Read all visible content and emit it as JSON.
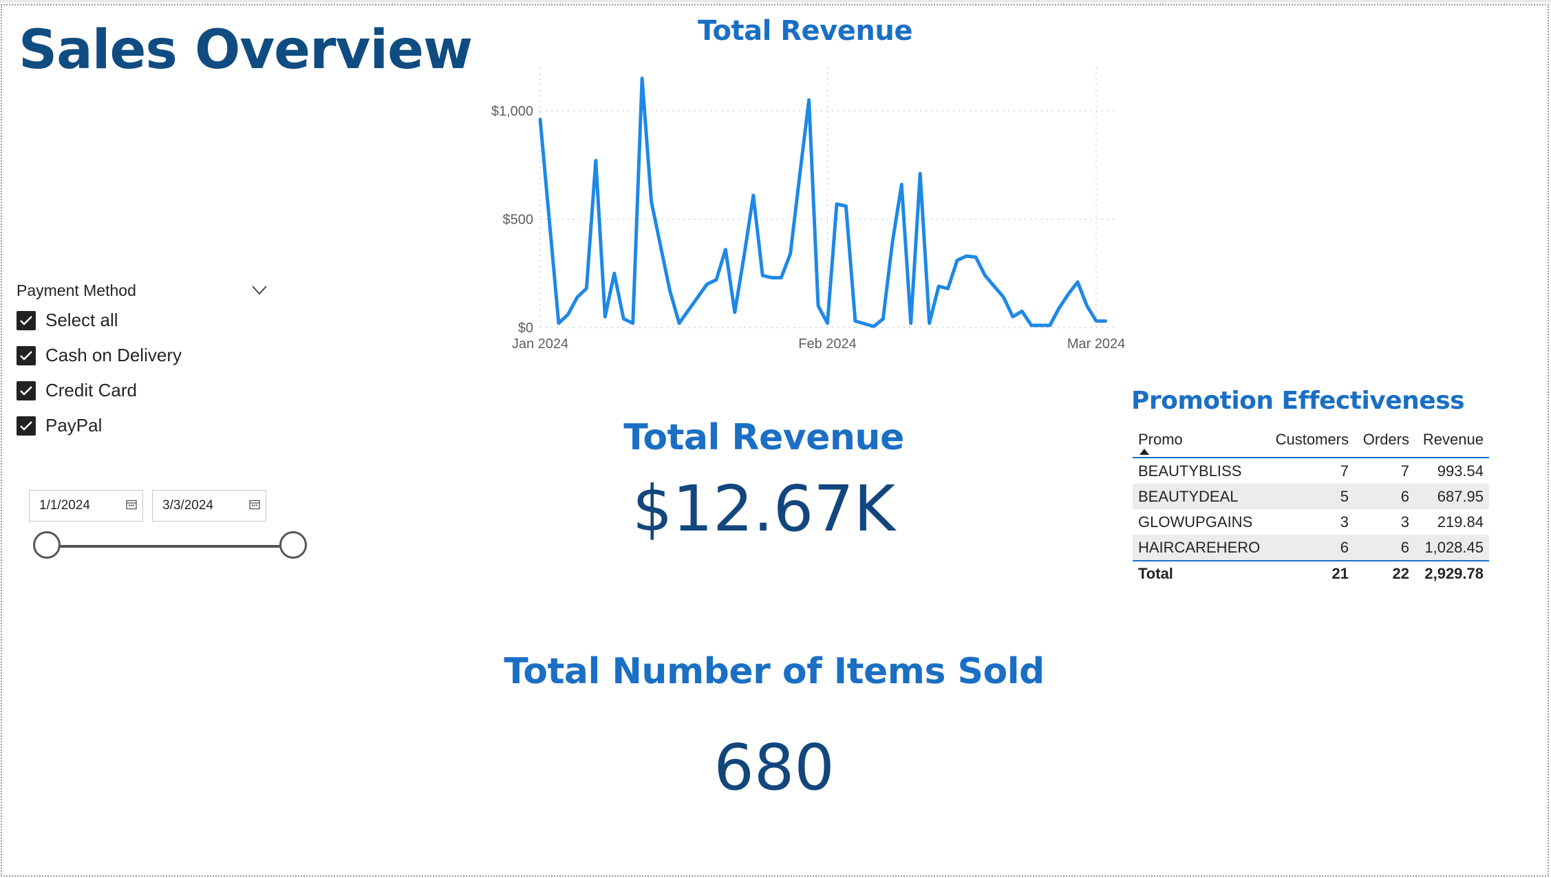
{
  "page_title": "Sales Overview",
  "slicer": {
    "title": "Payment Method",
    "items": [
      {
        "label": "Select all",
        "checked": true
      },
      {
        "label": "Cash on Delivery",
        "checked": true
      },
      {
        "label": "Credit Card",
        "checked": true
      },
      {
        "label": "PayPal",
        "checked": true
      }
    ]
  },
  "date_range": {
    "start": "1/1/2024",
    "end": "3/3/2024"
  },
  "chart_data": {
    "type": "line",
    "title": "Total Revenue",
    "x_start": "2024-01-01",
    "x_end": "2024-03-03",
    "x_ticks": [
      {
        "label": "Jan 2024",
        "date": "2024-01-01"
      },
      {
        "label": "Feb 2024",
        "date": "2024-02-01"
      },
      {
        "label": "Mar 2024",
        "date": "2024-03-01"
      }
    ],
    "y_ticks": [
      {
        "label": "$0",
        "value": 0
      },
      {
        "label": "$500",
        "value": 500
      },
      {
        "label": "$1,000",
        "value": 1000
      }
    ],
    "ylim": [
      0,
      1200
    ],
    "grid": true,
    "line_color": "#1e88e5",
    "series": [
      {
        "x": [
          "2024-01-01",
          "2024-01-03",
          "2024-01-04",
          "2024-01-05",
          "2024-01-06",
          "2024-01-07",
          "2024-01-08",
          "2024-01-09",
          "2024-01-10",
          "2024-01-11",
          "2024-01-12",
          "2024-01-13",
          "2024-01-15",
          "2024-01-16",
          "2024-01-17",
          "2024-01-18",
          "2024-01-19",
          "2024-01-20",
          "2024-01-21",
          "2024-01-22",
          "2024-01-23",
          "2024-01-24",
          "2024-01-25",
          "2024-01-26",
          "2024-01-27",
          "2024-01-28",
          "2024-01-29",
          "2024-01-30",
          "2024-01-31",
          "2024-02-01",
          "2024-02-02",
          "2024-02-03",
          "2024-02-04",
          "2024-02-06",
          "2024-02-07",
          "2024-02-08",
          "2024-02-09",
          "2024-02-10",
          "2024-02-11",
          "2024-02-12",
          "2024-02-13",
          "2024-02-14",
          "2024-02-15",
          "2024-02-16",
          "2024-02-17",
          "2024-02-18",
          "2024-02-19",
          "2024-02-20",
          "2024-02-21",
          "2024-02-22",
          "2024-02-23",
          "2024-02-24",
          "2024-02-25",
          "2024-02-26",
          "2024-02-27",
          "2024-02-28",
          "2024-02-29",
          "2024-03-01",
          "2024-03-02"
        ],
        "y": [
          960,
          20,
          60,
          140,
          180,
          770,
          50,
          250,
          40,
          20,
          1150,
          580,
          170,
          20,
          80,
          140,
          200,
          220,
          360,
          70,
          330,
          610,
          240,
          230,
          230,
          340,
          700,
          1050,
          100,
          20,
          570,
          560,
          30,
          5,
          40,
          390,
          660,
          20,
          710,
          20,
          190,
          180,
          310,
          330,
          325,
          240,
          190,
          140,
          50,
          75,
          10,
          10,
          10,
          90,
          155,
          210,
          100,
          30,
          30
        ]
      }
    ]
  },
  "cards": {
    "revenue": {
      "label": "Total Revenue",
      "value": "$12.67K"
    },
    "items": {
      "label": "Total Number of Items Sold",
      "value": "680"
    }
  },
  "promo_table": {
    "title": "Promotion Effectiveness",
    "headers": [
      "Promo",
      "Customers",
      "Orders",
      "Revenue"
    ],
    "rows": [
      [
        "BEAUTYBLISS",
        "7",
        "7",
        "993.54"
      ],
      [
        "BEAUTYDEAL",
        "5",
        "6",
        "687.95"
      ],
      [
        "GLOWUPGAINS",
        "3",
        "3",
        "219.84"
      ],
      [
        "HAIRCAREHERO",
        "6",
        "6",
        "1,028.45"
      ]
    ],
    "total": [
      "Total",
      "21",
      "22",
      "2,929.78"
    ]
  }
}
